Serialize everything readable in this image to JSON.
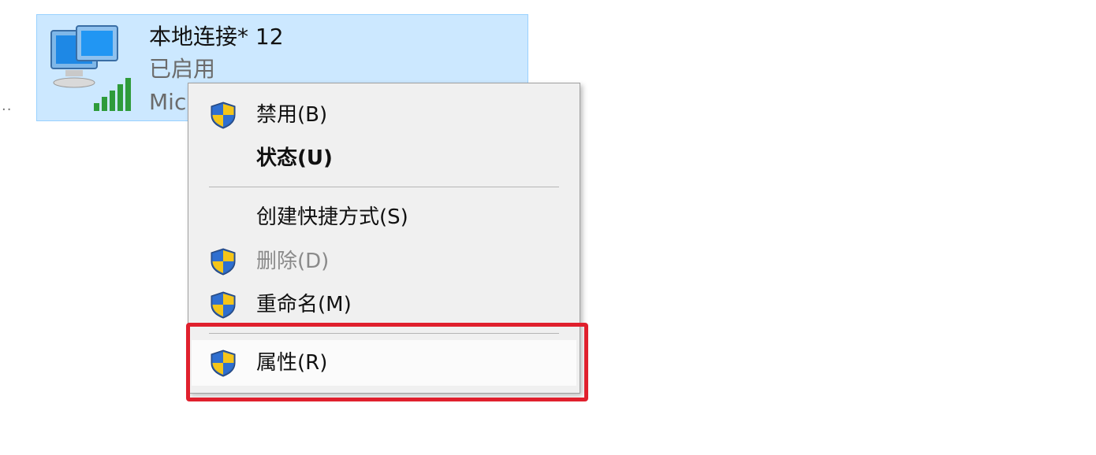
{
  "connection": {
    "name": "本地连接* 12",
    "status": "已启用",
    "device_partial": "Mic",
    "icon": "network-computers-signal-icon"
  },
  "context_menu": {
    "items": [
      {
        "label": "禁用(B)",
        "icon": "uac-shield-icon",
        "style": "normal"
      },
      {
        "label": "状态(U)",
        "icon": null,
        "style": "bold"
      },
      {
        "label": "创建快捷方式(S)",
        "icon": null,
        "style": "normal"
      },
      {
        "label": "删除(D)",
        "icon": "uac-shield-icon",
        "style": "disabled"
      },
      {
        "label": "重命名(M)",
        "icon": "uac-shield-icon",
        "style": "normal"
      },
      {
        "label": "属性(R)",
        "icon": "uac-shield-icon",
        "style": "highlighted"
      }
    ]
  },
  "colors": {
    "selection_bg": "#cce8ff",
    "annotation_red": "#e0202d"
  }
}
